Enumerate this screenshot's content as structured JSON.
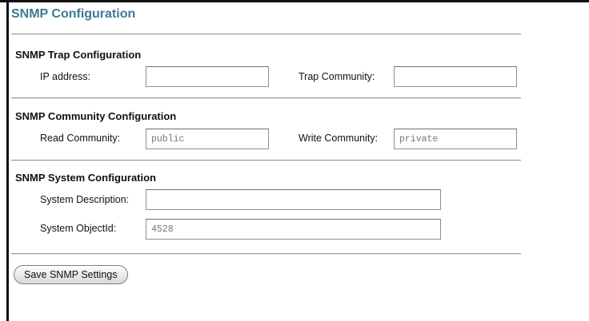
{
  "page": {
    "title": "SNMP Configuration"
  },
  "trap": {
    "title": "SNMP Trap Configuration",
    "ip_label": "IP address:",
    "ip_value": "",
    "community_label": "Trap Community:",
    "community_value": ""
  },
  "community": {
    "title": "SNMP Community Configuration",
    "read_label": "Read Community:",
    "read_value": "public",
    "write_label": "Write Community:",
    "write_value": "private"
  },
  "system": {
    "title": "SNMP System Configuration",
    "description_label": "System Description:",
    "description_value": "",
    "objectid_label": "System ObjectId:",
    "objectid_value": "4528"
  },
  "actions": {
    "save_label": "Save SNMP Settings"
  },
  "colors": {
    "title": "#3b7a93",
    "rule": "#9a9a9a",
    "frame": "#111111"
  }
}
